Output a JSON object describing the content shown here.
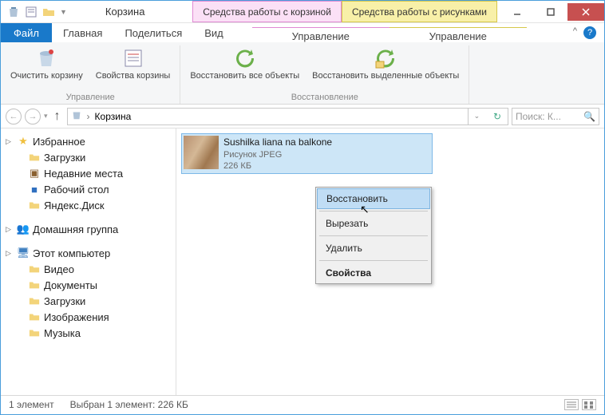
{
  "title": "Корзина",
  "contextual_tabs": [
    {
      "label": "Средства работы с корзиной",
      "sub": "Управление"
    },
    {
      "label": "Средства работы с рисунками",
      "sub": "Управление"
    }
  ],
  "file_tab": "Файл",
  "ribbon_tabs": [
    "Главная",
    "Поделиться",
    "Вид"
  ],
  "ribbon": {
    "group1_label": "Управление",
    "group2_label": "Восстановление",
    "btn_clear": "Очистить корзину",
    "btn_props": "Свойства корзины",
    "btn_restore_all": "Восстановить все объекты",
    "btn_restore_sel": "Восстановить выделенные объекты"
  },
  "breadcrumb": "Корзина",
  "search_placeholder": "Поиск: К...",
  "sidebar": {
    "favorites": "Избранное",
    "downloads": "Загрузки",
    "recent": "Недавние места",
    "desktop": "Рабочий стол",
    "yadisk": "Яндекс.Диск",
    "homegroup": "Домашняя группа",
    "thispc": "Этот компьютер",
    "video": "Видео",
    "documents": "Документы",
    "downloads2": "Загрузки",
    "images": "Изображения",
    "music": "Музыка"
  },
  "file": {
    "name": "Sushilka liana na balkone",
    "type": "Рисунок JPEG",
    "size": "226 КБ"
  },
  "context_menu": {
    "restore": "Восстановить",
    "cut": "Вырезать",
    "delete": "Удалить",
    "properties": "Свойства"
  },
  "status": {
    "count": "1 элемент",
    "selection": "Выбран 1 элемент: 226 КБ"
  }
}
